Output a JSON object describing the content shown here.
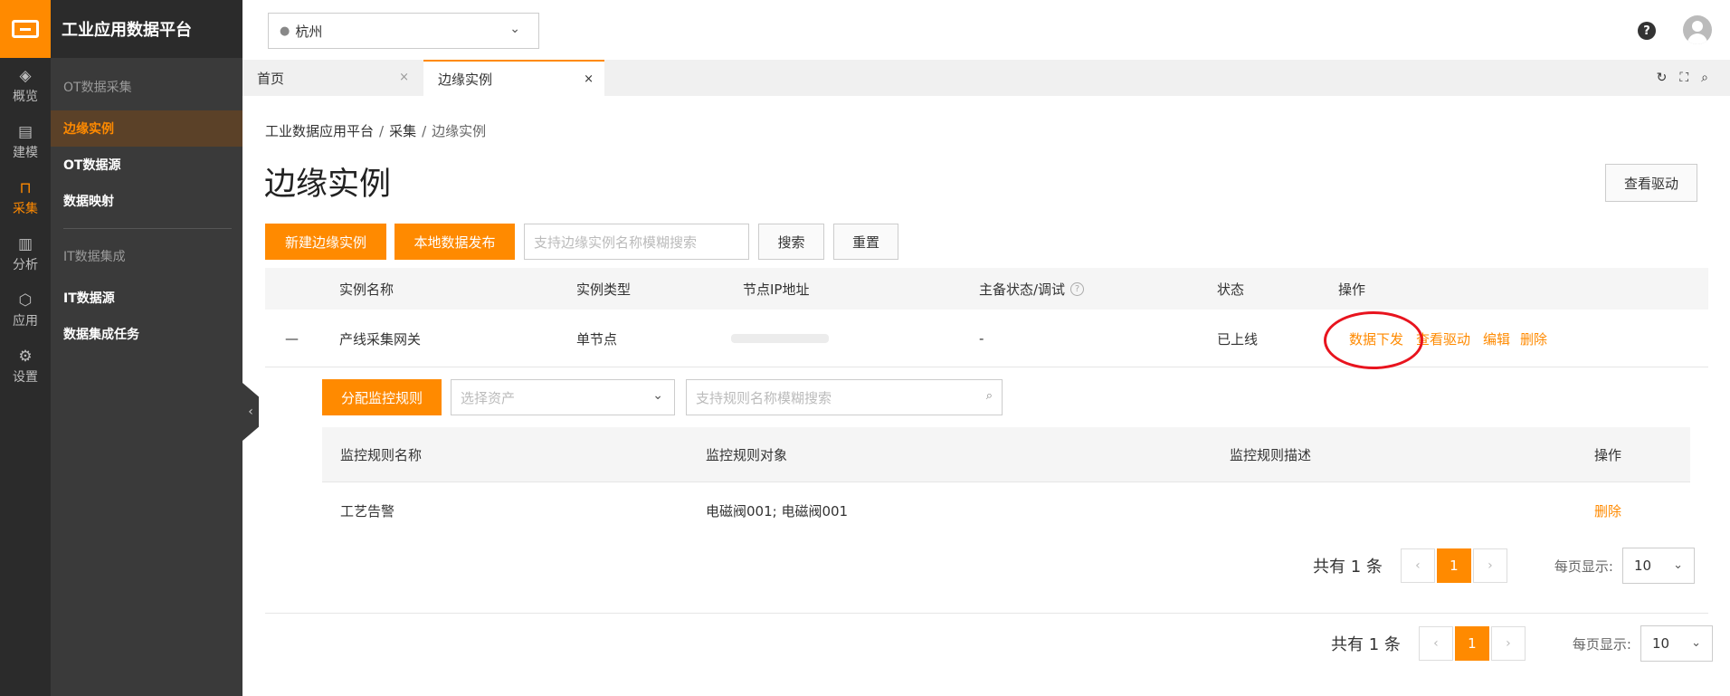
{
  "app": {
    "brand": "工业应用数据平台"
  },
  "rail": [
    {
      "icon": "layers-icon",
      "label": "概览"
    },
    {
      "icon": "model-icon",
      "label": "建模"
    },
    {
      "icon": "collect-icon",
      "label": "采集",
      "active": true
    },
    {
      "icon": "chart-icon",
      "label": "分析"
    },
    {
      "icon": "cube-icon",
      "label": "应用"
    },
    {
      "icon": "gear-icon",
      "label": "设置"
    }
  ],
  "sidebar": {
    "group1": "OT数据采集",
    "items1": [
      "边缘实例",
      "OT数据源",
      "数据映射"
    ],
    "group2": "IT数据集成",
    "items2": [
      "IT数据源",
      "数据集成任务"
    ]
  },
  "topbar": {
    "city": "杭州",
    "help": "?"
  },
  "tabs": [
    {
      "label": "首页",
      "close": "×"
    },
    {
      "label": "边缘实例",
      "close": "×",
      "active": true
    }
  ],
  "tools": [
    "↻",
    "⛶",
    "⌕"
  ],
  "breadcrumb": {
    "root": "工业数据应用平台",
    "mid": "采集",
    "current": "边缘实例",
    "sep": "/"
  },
  "page": {
    "title": "边缘实例",
    "view_driver": "查看驱动"
  },
  "toolbar": {
    "new_instance": "新建边缘实例",
    "publish_local": "本地数据发布",
    "search_placeholder": "支持边缘实例名称模糊搜索",
    "search": "搜索",
    "reset": "重置"
  },
  "table": {
    "headers": [
      "实例名称",
      "实例类型",
      "节点IP地址",
      "主备状态/调试",
      "状态",
      "操作"
    ],
    "row": {
      "expand": "—",
      "name": "产线采集网关",
      "type": "单节点",
      "ip": "",
      "ha": "-",
      "status": "已上线",
      "actions": [
        "数据下发",
        "查看驱动",
        "编辑",
        "删除"
      ]
    }
  },
  "subpanel": {
    "assign_rule": "分配监控规则",
    "asset_placeholder": "选择资产",
    "rule_search_placeholder": "支持规则名称模糊搜索",
    "headers": [
      "监控规则名称",
      "监控规则对象",
      "监控规则描述",
      "操作"
    ],
    "row": {
      "name": "工艺告警",
      "object": "电磁阀001; 电磁阀001",
      "desc": "",
      "action": "删除"
    }
  },
  "pagination_inner": {
    "total": "共有 1 条",
    "page": "1",
    "per_page_label": "每页显示:",
    "per_page": "10"
  },
  "pagination_outer": {
    "total": "共有 1 条",
    "page": "1",
    "per_page_label": "每页显示:",
    "per_page": "10"
  },
  "colors": {
    "accent": "#ff8a00",
    "highlight_ring": "#e8141e"
  }
}
